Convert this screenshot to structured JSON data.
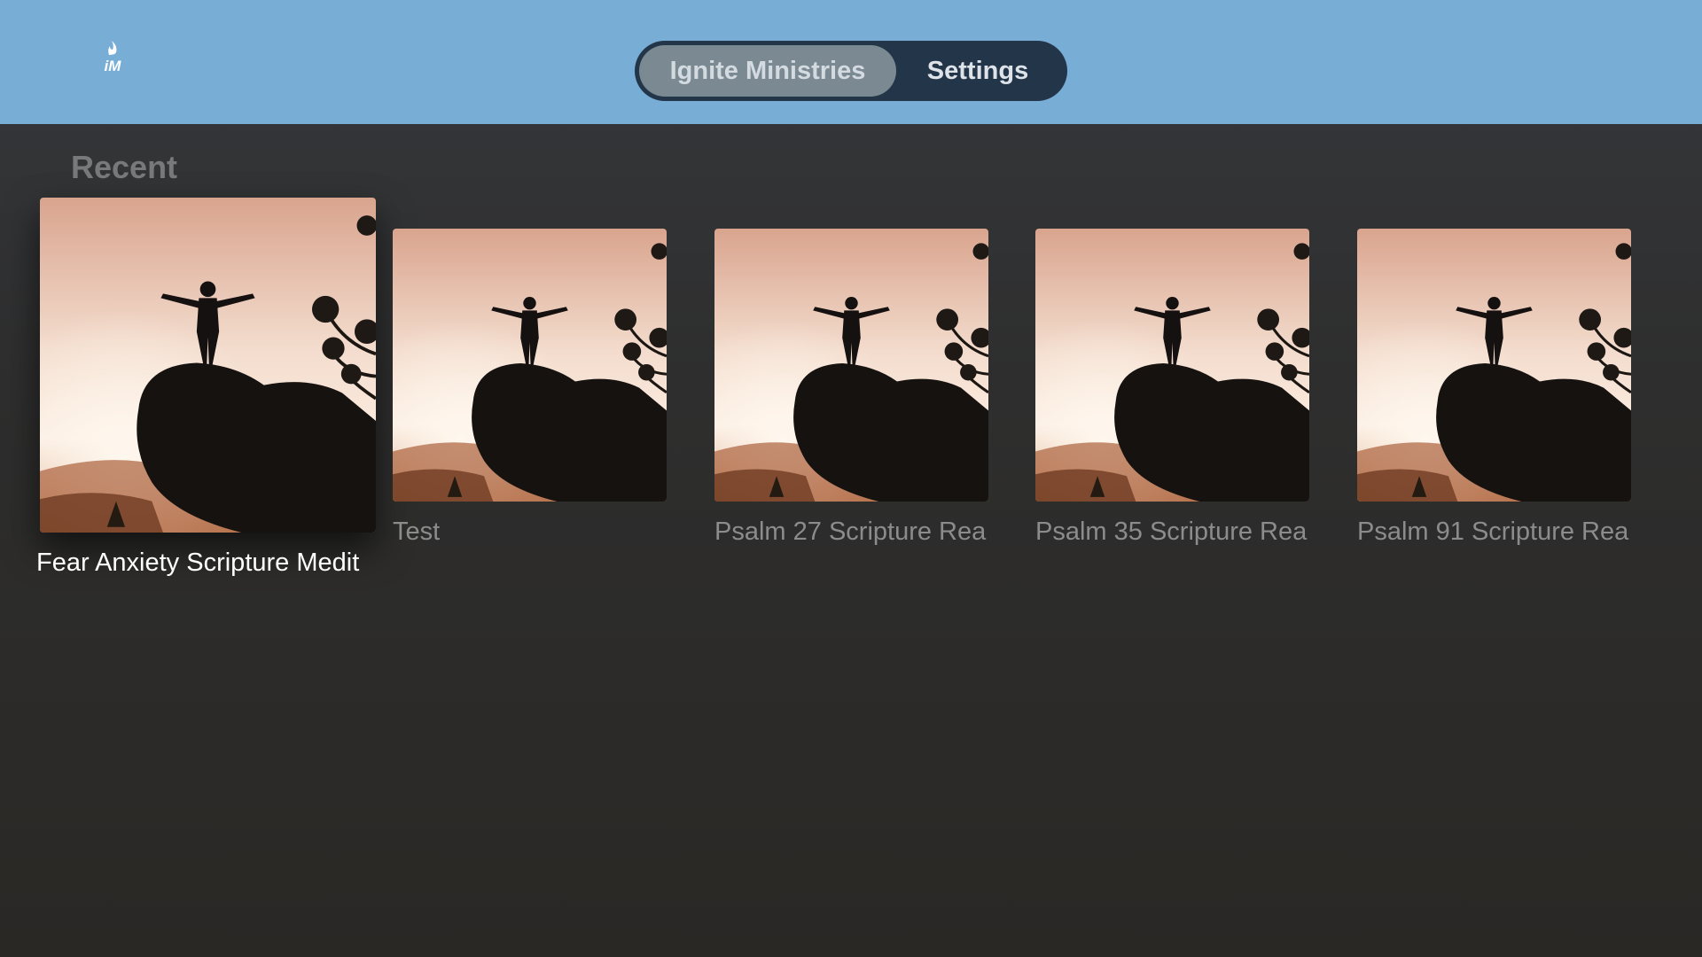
{
  "header": {
    "logo_text": "iM",
    "tabs": [
      {
        "label": "Ignite Ministries",
        "selected": true
      },
      {
        "label": "Settings",
        "selected": false
      }
    ]
  },
  "recent": {
    "title": "Recent",
    "items": [
      {
        "label": "Fear Anxiety Scripture Medit",
        "focused": true
      },
      {
        "label": "Test",
        "focused": false
      },
      {
        "label": "Psalm 27 Scripture Rea",
        "focused": false
      },
      {
        "label": "Psalm 35 Scripture Rea",
        "focused": false
      },
      {
        "label": "Psalm 91 Scripture Rea",
        "focused": false
      }
    ]
  },
  "colors": {
    "header_bg": "#78add6",
    "tabbar_bg": "#233548",
    "tab_selected_bg": "#7b8993"
  }
}
